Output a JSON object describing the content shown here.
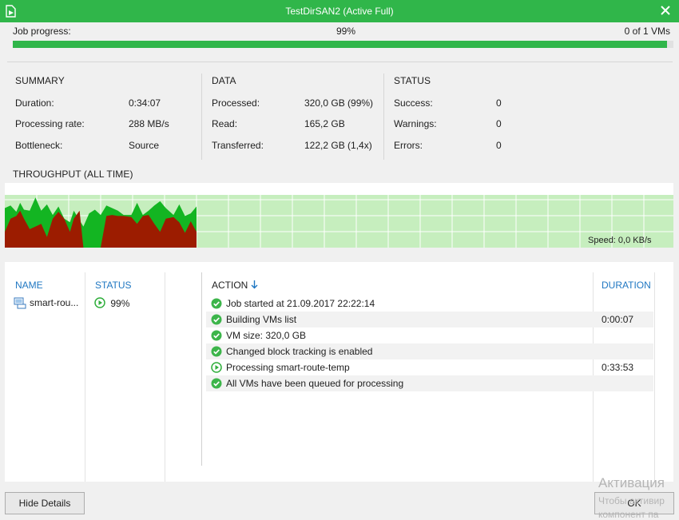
{
  "window": {
    "title": "TestDirSAN2 (Active Full)"
  },
  "job_progress": {
    "label": "Job progress:",
    "percent_text": "99%",
    "percent": 99,
    "vms_text": "0 of 1 VMs"
  },
  "summary": {
    "heading": "SUMMARY",
    "duration": {
      "label": "Duration:",
      "value": "0:34:07"
    },
    "processing_rate": {
      "label": "Processing rate:",
      "value": "288 MB/s"
    },
    "bottleneck": {
      "label": "Bottleneck:",
      "value": "Source"
    }
  },
  "data_section": {
    "heading": "DATA",
    "processed": {
      "label": "Processed:",
      "value": "320,0 GB (99%)"
    },
    "read": {
      "label": "Read:",
      "value": "165,2 GB"
    },
    "transferred": {
      "label": "Transferred:",
      "value": "122,2 GB (1,4x)"
    }
  },
  "status_section": {
    "heading": "STATUS",
    "success": {
      "label": "Success:",
      "value": "0"
    },
    "warnings": {
      "label": "Warnings:",
      "value": "0"
    },
    "errors": {
      "label": "Errors:",
      "value": "0"
    }
  },
  "throughput": {
    "heading": "THROUGHPUT (ALL TIME)",
    "speed": "Speed: 0,0 KB/s",
    "colors": {
      "read": "#13b522",
      "transferred": "#9c1c00",
      "background": "#c6eebe",
      "grid": "#ffffff"
    },
    "chart_data": {
      "type": "area",
      "title": "THROUGHPUT (ALL TIME)",
      "x_progress_fraction": [
        0.0,
        0.03,
        0.06,
        0.08,
        0.1,
        0.13,
        0.16,
        0.19,
        0.22,
        0.25,
        0.28,
        0.31,
        0.34,
        0.36,
        0.39,
        0.41,
        0.44,
        0.47,
        0.5,
        0.53,
        0.56,
        0.59,
        0.62,
        0.66,
        0.69,
        0.72,
        0.75,
        0.78,
        0.81,
        0.84,
        0.88,
        0.91,
        0.94,
        0.97,
        1.0
      ],
      "series": [
        {
          "values": [
            0.75,
            0.8,
            0.68,
            0.85,
            0.72,
            0.7,
            0.95,
            0.7,
            0.82,
            0.62,
            0.78,
            0.55,
            0.48,
            0.7,
            0.52,
            0.4,
            0.65,
            0.72,
            0.62,
            0.8,
            0.75,
            0.7,
            0.62,
            0.62,
            0.85,
            0.62,
            0.7,
            0.8,
            0.88,
            0.75,
            0.62,
            0.82,
            0.6,
            0.65,
            0.78
          ]
        },
        {
          "values": [
            0.3,
            0.55,
            0.6,
            0.7,
            0.55,
            0.35,
            0.4,
            0.45,
            0.2,
            0.55,
            0.68,
            0.55,
            0.3,
            0.55,
            0.7,
            0.0,
            0.0,
            0.0,
            0.0,
            0.6,
            0.62,
            0.6,
            0.6,
            0.58,
            0.45,
            0.6,
            0.62,
            0.45,
            0.3,
            0.55,
            0.58,
            0.48,
            0.28,
            0.5,
            0.3
          ]
        }
      ]
    }
  },
  "table": {
    "col_name": "NAME",
    "col_status": "STATUS",
    "col_action": "ACTION",
    "col_duration": "DURATION",
    "vm": {
      "name": "smart-rou...",
      "status": "99%"
    },
    "actions": [
      {
        "text": "Job started at 21.09.2017 22:22:14",
        "duration": "",
        "icon": "success-check-icon"
      },
      {
        "text": "Building VMs list",
        "duration": "0:00:07",
        "icon": "success-check-icon"
      },
      {
        "text": "VM size: 320,0 GB",
        "duration": "",
        "icon": "success-check-icon"
      },
      {
        "text": "Changed block tracking is enabled",
        "duration": "",
        "icon": "success-check-icon"
      },
      {
        "text": "Processing smart-route-temp",
        "duration": "0:33:53",
        "icon": "in-progress-play-icon"
      },
      {
        "text": "All VMs have been queued for processing",
        "duration": "",
        "icon": "success-check-icon"
      }
    ]
  },
  "buttons": {
    "hide_details": "Hide Details",
    "ok": "OK"
  },
  "watermark": {
    "line1": "Активация",
    "line2": "Чтобы активир",
    "line3": "компонент па"
  }
}
